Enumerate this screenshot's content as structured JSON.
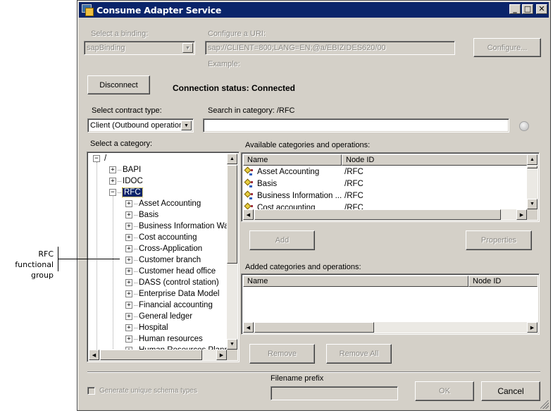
{
  "window": {
    "title": "Consume Adapter Service",
    "controls": {
      "minimize": "_",
      "maximize": "□",
      "close": "✕"
    }
  },
  "binding": {
    "label": "Select a binding:",
    "value": "sapBinding",
    "enabled": false
  },
  "uri": {
    "label": "Configure a URI:",
    "value": "sap://CLIENT=800;LANG=EN;@a/EBIZIDES620/00",
    "example_label": "Example:",
    "configure_button": "Configure..."
  },
  "connection": {
    "disconnect_button": "Disconnect",
    "status_text": "Connection status: Connected"
  },
  "contract": {
    "label": "Select contract type:",
    "value": "Client (Outbound operations)"
  },
  "search": {
    "label": "Search in category: /RFC",
    "value": "",
    "go_icon": "search-go-icon"
  },
  "category_tree": {
    "label": "Select a category:",
    "nodes": [
      {
        "label": "/",
        "level": 0,
        "expanded": true
      },
      {
        "label": "BAPI",
        "level": 1,
        "expanded": false
      },
      {
        "label": "IDOC",
        "level": 1,
        "expanded": false
      },
      {
        "label": "RFC",
        "level": 1,
        "expanded": true,
        "selected": true
      },
      {
        "label": "Asset Accounting",
        "level": 2,
        "expanded": false
      },
      {
        "label": "Basis",
        "level": 2,
        "expanded": false
      },
      {
        "label": "Business Information Warehouse",
        "level": 2,
        "expanded": false
      },
      {
        "label": "Cost accounting",
        "level": 2,
        "expanded": false
      },
      {
        "label": "Cross-Application",
        "level": 2,
        "expanded": false
      },
      {
        "label": "Customer branch",
        "level": 2,
        "expanded": false
      },
      {
        "label": "Customer head office",
        "level": 2,
        "expanded": false
      },
      {
        "label": "DASS (control station)",
        "level": 2,
        "expanded": false
      },
      {
        "label": "Enterprise Data Model",
        "level": 2,
        "expanded": false
      },
      {
        "label": "Financial accounting",
        "level": 2,
        "expanded": false
      },
      {
        "label": "General ledger",
        "level": 2,
        "expanded": false
      },
      {
        "label": "Hospital",
        "level": 2,
        "expanded": false
      },
      {
        "label": "Human resources",
        "level": 2,
        "expanded": false
      },
      {
        "label": "Human Resources Planning",
        "level": 2,
        "expanded": false
      }
    ]
  },
  "available": {
    "label": "Available categories and operations:",
    "columns": [
      "Name",
      "Node ID"
    ],
    "rows": [
      {
        "name": "Asset Accounting",
        "node_id": "/RFC"
      },
      {
        "name": "Basis",
        "node_id": "/RFC"
      },
      {
        "name": "Business Information ...",
        "node_id": "/RFC"
      },
      {
        "name": "Cost accounting",
        "node_id": "/RFC"
      }
    ]
  },
  "actions": {
    "add_button": "Add",
    "properties_button": "Properties",
    "remove_button": "Remove",
    "remove_all_button": "Remove All"
  },
  "added": {
    "label": "Added categories and operations:",
    "columns": [
      "Name",
      "Node ID"
    ],
    "rows": []
  },
  "footer": {
    "unique_schema_label": "Generate unique schema types",
    "unique_schema_checked": false,
    "filename_prefix_label": "Filename prefix",
    "filename_prefix_value": "",
    "ok_button": "OK",
    "cancel_button": "Cancel"
  },
  "callout": {
    "text_line1": "RFC functional",
    "text_line2": "group"
  }
}
